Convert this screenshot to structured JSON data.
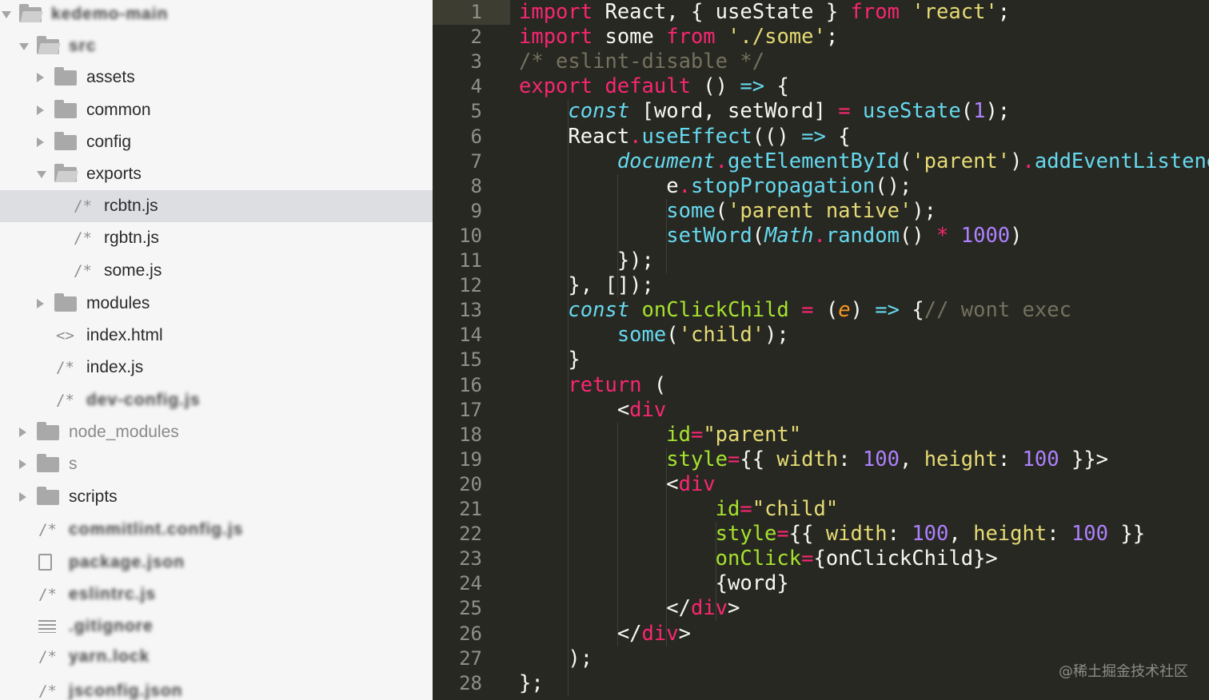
{
  "sidebar": {
    "items": [
      {
        "label": "kedemo-main",
        "type": "folder-open",
        "expanded": true,
        "blurred": true
      },
      {
        "label": "src",
        "type": "folder-open",
        "expanded": true,
        "blurred": true
      },
      {
        "label": "assets",
        "type": "folder",
        "expanded": false
      },
      {
        "label": "common",
        "type": "folder",
        "expanded": false
      },
      {
        "label": "config",
        "type": "folder",
        "expanded": false
      },
      {
        "label": "exports",
        "type": "folder-open",
        "expanded": true
      },
      {
        "label": "rcbtn.js",
        "type": "js-file",
        "selected": true
      },
      {
        "label": "rgbtn.js",
        "type": "js-file"
      },
      {
        "label": "some.js",
        "type": "js-file"
      },
      {
        "label": "modules",
        "type": "folder",
        "expanded": false
      },
      {
        "label": "index.html",
        "type": "html-file"
      },
      {
        "label": "index.js",
        "type": "js-file"
      },
      {
        "label": "dev-config.js",
        "type": "js-file",
        "blurred": true
      },
      {
        "label": "node_modules",
        "type": "folder",
        "expanded": false,
        "dim": true
      },
      {
        "label": "s",
        "type": "folder",
        "expanded": false,
        "dim": true
      },
      {
        "label": "scripts",
        "type": "folder",
        "expanded": false
      },
      {
        "label": "commitlint.config.js",
        "type": "js-file",
        "blurred": true
      },
      {
        "label": "package.json",
        "type": "file",
        "blurred": true
      },
      {
        "label": "eslintrc.js",
        "type": "js-file",
        "blurred": true
      },
      {
        "label": ".gitignore",
        "type": "lines-file",
        "blurred": true
      },
      {
        "label": "yarn.lock",
        "type": "js-file",
        "blurred": true
      },
      {
        "label": "jsconfig.json",
        "type": "js-file",
        "blurred": true
      }
    ]
  },
  "editor": {
    "active_line": 1,
    "lines": [
      [
        [
          "kw",
          "import"
        ],
        [
          "pl",
          " React, { useState } "
        ],
        [
          "kw",
          "from"
        ],
        [
          "pl",
          " "
        ],
        [
          "str",
          "'react'"
        ],
        [
          "pl",
          ";"
        ]
      ],
      [
        [
          "kw",
          "import"
        ],
        [
          "pl",
          " some "
        ],
        [
          "kw",
          "from"
        ],
        [
          "pl",
          " "
        ],
        [
          "str",
          "'./some'"
        ],
        [
          "pl",
          ";"
        ]
      ],
      [
        [
          "cmt",
          "/* eslint-disable */"
        ]
      ],
      [
        [
          "kw",
          "export"
        ],
        [
          "pl",
          " "
        ],
        [
          "kw",
          "default"
        ],
        [
          "pl",
          " () "
        ],
        [
          "fn",
          "=>"
        ],
        [
          "pl",
          " {"
        ]
      ],
      [
        [
          "pl",
          "    "
        ],
        [
          "ital",
          "const"
        ],
        [
          "pl",
          " [word, setWord] "
        ],
        [
          "op",
          "="
        ],
        [
          "pl",
          " "
        ],
        [
          "fn",
          "useState"
        ],
        [
          "pl",
          "("
        ],
        [
          "num",
          "1"
        ],
        [
          "pl",
          ");"
        ]
      ],
      [
        [
          "pl",
          "    React"
        ],
        [
          "op",
          "."
        ],
        [
          "fn",
          "useEffect"
        ],
        [
          "pl",
          "(() "
        ],
        [
          "fn",
          "=>"
        ],
        [
          "pl",
          " {"
        ]
      ],
      [
        [
          "pl",
          "        "
        ],
        [
          "ital",
          "document"
        ],
        [
          "op",
          "."
        ],
        [
          "fn",
          "getElementById"
        ],
        [
          "pl",
          "("
        ],
        [
          "str",
          "'parent'"
        ],
        [
          "pl",
          ")"
        ],
        [
          "op",
          "."
        ],
        [
          "fn",
          "addEventListener"
        ],
        [
          "pl",
          "("
        ]
      ],
      [
        [
          "pl",
          "            e"
        ],
        [
          "op",
          "."
        ],
        [
          "fn",
          "stopPropagation"
        ],
        [
          "pl",
          "();"
        ]
      ],
      [
        [
          "pl",
          "            "
        ],
        [
          "fn",
          "some"
        ],
        [
          "pl",
          "("
        ],
        [
          "str",
          "'parent native'"
        ],
        [
          "pl",
          ");"
        ]
      ],
      [
        [
          "pl",
          "            "
        ],
        [
          "fn",
          "setWord"
        ],
        [
          "pl",
          "("
        ],
        [
          "ital",
          "Math"
        ],
        [
          "op",
          "."
        ],
        [
          "fn",
          "random"
        ],
        [
          "pl",
          "() "
        ],
        [
          "op",
          "*"
        ],
        [
          "pl",
          " "
        ],
        [
          "num",
          "1000"
        ],
        [
          "pl",
          ")"
        ]
      ],
      [
        [
          "pl",
          "        });"
        ]
      ],
      [
        [
          "pl",
          "    }, []);"
        ]
      ],
      [
        [
          "pl",
          "    "
        ],
        [
          "ital",
          "const"
        ],
        [
          "pl",
          " "
        ],
        [
          "attr",
          "onClickChild"
        ],
        [
          "pl",
          " "
        ],
        [
          "op",
          "="
        ],
        [
          "pl",
          " ("
        ],
        [
          "param",
          "e"
        ],
        [
          "pl",
          ") "
        ],
        [
          "fn",
          "=>"
        ],
        [
          "pl",
          " {"
        ],
        [
          "cmt",
          "// wont exec"
        ]
      ],
      [
        [
          "pl",
          "        "
        ],
        [
          "fn",
          "some"
        ],
        [
          "pl",
          "("
        ],
        [
          "str",
          "'child'"
        ],
        [
          "pl",
          ");"
        ]
      ],
      [
        [
          "pl",
          "    }"
        ]
      ],
      [
        [
          "pl",
          "    "
        ],
        [
          "kw",
          "return"
        ],
        [
          "pl",
          " ("
        ]
      ],
      [
        [
          "pl",
          "        <"
        ],
        [
          "kw",
          "div"
        ]
      ],
      [
        [
          "pl",
          "            "
        ],
        [
          "attr",
          "id"
        ],
        [
          "op",
          "="
        ],
        [
          "str",
          "\"parent\""
        ]
      ],
      [
        [
          "pl",
          "            "
        ],
        [
          "attr",
          "style"
        ],
        [
          "op",
          "="
        ],
        [
          "pl",
          "{{ "
        ],
        [
          "str",
          "width"
        ],
        [
          "pl",
          ": "
        ],
        [
          "num",
          "100"
        ],
        [
          "pl",
          ", "
        ],
        [
          "str",
          "height"
        ],
        [
          "pl",
          ": "
        ],
        [
          "num",
          "100"
        ],
        [
          "pl",
          " }}>"
        ]
      ],
      [
        [
          "pl",
          "            <"
        ],
        [
          "kw",
          "div"
        ]
      ],
      [
        [
          "pl",
          "                "
        ],
        [
          "attr",
          "id"
        ],
        [
          "op",
          "="
        ],
        [
          "str",
          "\"child\""
        ]
      ],
      [
        [
          "pl",
          "                "
        ],
        [
          "attr",
          "style"
        ],
        [
          "op",
          "="
        ],
        [
          "pl",
          "{{ "
        ],
        [
          "str",
          "width"
        ],
        [
          "pl",
          ": "
        ],
        [
          "num",
          "100"
        ],
        [
          "pl",
          ", "
        ],
        [
          "str",
          "height"
        ],
        [
          "pl",
          ": "
        ],
        [
          "num",
          "100"
        ],
        [
          "pl",
          " }}"
        ]
      ],
      [
        [
          "pl",
          "                "
        ],
        [
          "attr",
          "onClick"
        ],
        [
          "op",
          "="
        ],
        [
          "pl",
          "{onClickChild}>"
        ]
      ],
      [
        [
          "pl",
          "                {word}"
        ]
      ],
      [
        [
          "pl",
          "            </"
        ],
        [
          "kw",
          "div"
        ],
        [
          "pl",
          ">"
        ]
      ],
      [
        [
          "pl",
          "        </"
        ],
        [
          "kw",
          "div"
        ],
        [
          "pl",
          ">"
        ]
      ],
      [
        [
          "pl",
          "    );"
        ]
      ],
      [
        [
          "pl",
          "};"
        ]
      ]
    ]
  },
  "watermark": "@稀土掘金技术社区"
}
